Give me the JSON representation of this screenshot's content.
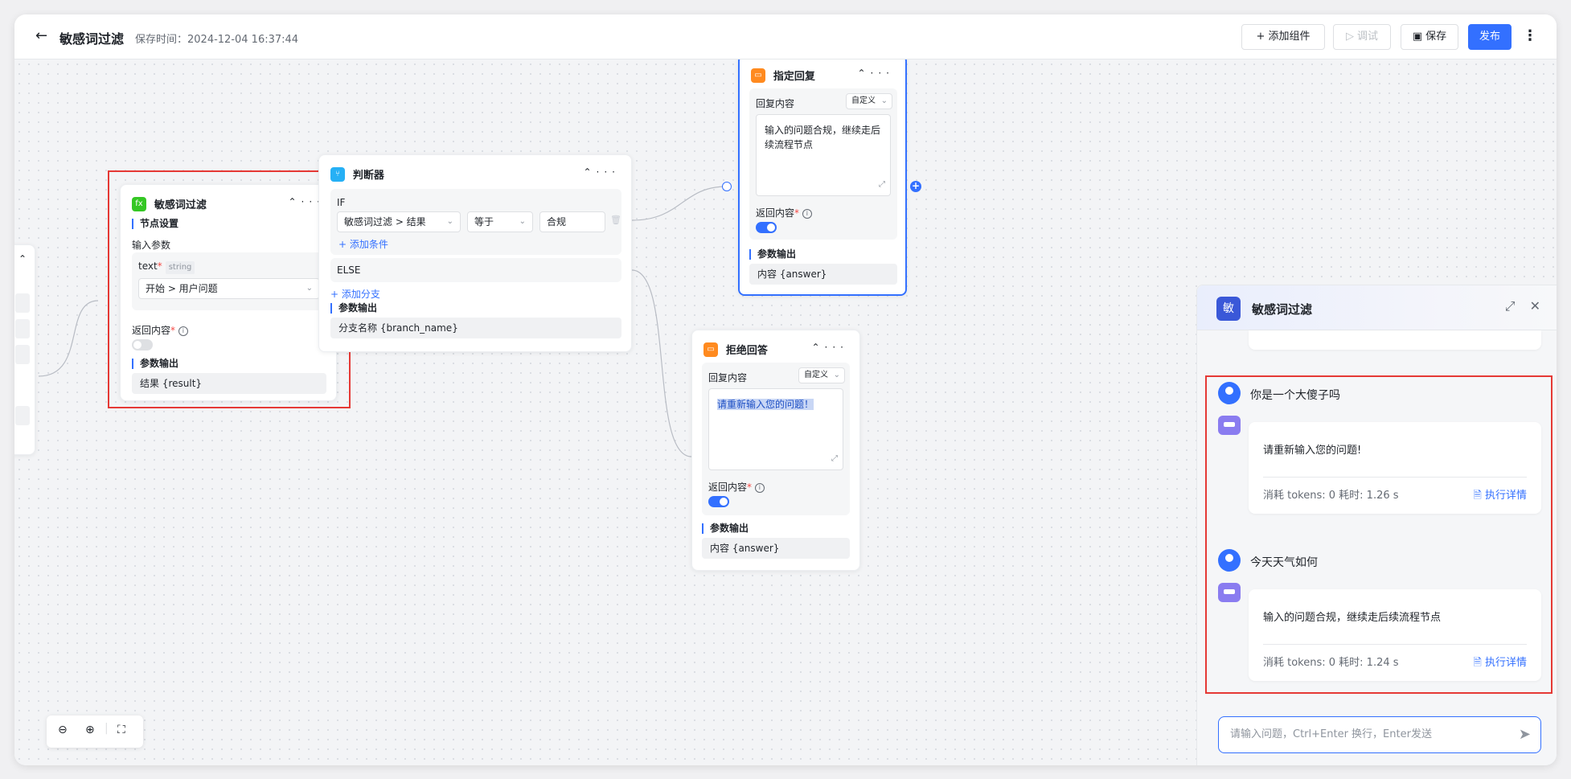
{
  "header": {
    "title": "敏感词过滤",
    "save_time": "保存时间：2024-12-04 16:37:44",
    "add_component": "添加组件",
    "debug": "调试",
    "save": "保存",
    "publish": "发布"
  },
  "node_filter": {
    "title": "敏感词过滤",
    "section_settings": "节点设置",
    "input_params": "输入参数",
    "param_name": "text",
    "param_type": "string",
    "param_value": "开始 > 用户问题",
    "return_content": "返回内容",
    "section_output": "参数输出",
    "output": "结果 {result}"
  },
  "node_judge": {
    "title": "判断器",
    "if": "IF",
    "cond_field": "敏感词过滤 > 结果",
    "cond_op": "等于",
    "cond_value": "合规",
    "add_condition": "添加条件",
    "else": "ELSE",
    "add_branch": "添加分支",
    "section_output": "参数输出",
    "output": "分支名称 {branch_name}"
  },
  "node_reply": {
    "title": "指定回复",
    "reply_label": "回复内容",
    "mode": "自定义",
    "content": "输入的问题合规，继续走后续流程节点",
    "return_content": "返回内容",
    "section_output": "参数输出",
    "output": "内容 {answer}"
  },
  "node_reject": {
    "title": "拒绝回答",
    "reply_label": "回复内容",
    "mode": "自定义",
    "content": "请重新输入您的问题！",
    "return_content": "返回内容",
    "section_output": "参数输出",
    "output": "内容 {answer}"
  },
  "panel": {
    "avatar": "敏",
    "title": "敏感词过滤",
    "messages": [
      {
        "question": "你是一个大傻子吗",
        "answer": "请重新输入您的问题!",
        "stats": "消耗 tokens: 0   耗时: 1.26 s",
        "detail": "执行详情"
      },
      {
        "question": "今天天气如何",
        "answer": "输入的问题合规，继续走后续流程节点",
        "stats": "消耗 tokens: 0   耗时: 1.24 s",
        "detail": "执行详情"
      }
    ],
    "input_placeholder": "请输入问题，Ctrl+Enter 换行，Enter发送"
  },
  "colors": {
    "accent": "#3370ff",
    "highlight_box": "#e53935"
  }
}
